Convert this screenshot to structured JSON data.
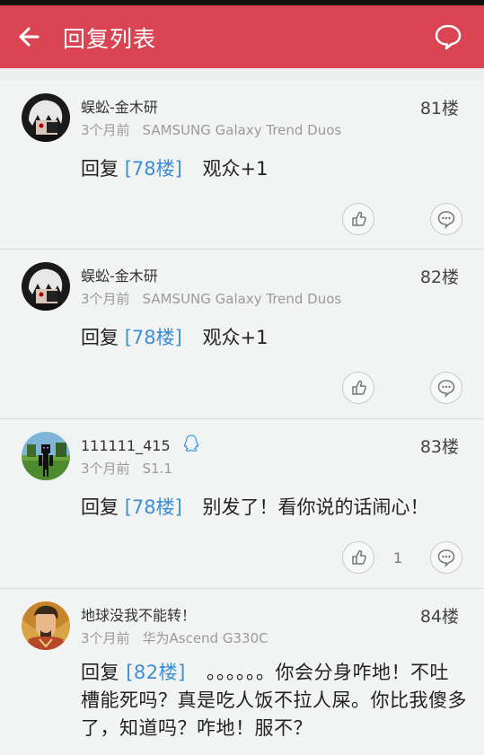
{
  "header": {
    "title": "回复列表"
  },
  "replies": [
    {
      "name": "蜈蚣-金木研",
      "floor": "81楼",
      "time": "3个月前",
      "device": "SAMSUNG Galaxy Trend Duos",
      "reply_prefix": "回复",
      "reply_ref": "[78楼]",
      "text": "观众+1",
      "like_count": "",
      "avatar_icon": "kaneki-avatar"
    },
    {
      "name": "蜈蚣-金木研",
      "floor": "82楼",
      "time": "3个月前",
      "device": "SAMSUNG Galaxy Trend Duos",
      "reply_prefix": "回复",
      "reply_ref": "[78楼]",
      "text": "观众+1",
      "like_count": "",
      "avatar_icon": "kaneki-avatar"
    },
    {
      "name": "111111_415",
      "floor": "83楼",
      "time": "3个月前",
      "device": "S1.1",
      "reply_prefix": "回复",
      "reply_ref": "[78楼]",
      "text": "别发了！看你说的话闹心！",
      "like_count": "1",
      "avatar_icon": "minecraft-avatar",
      "badge_icon": "qq-icon"
    },
    {
      "name": "地球没我不能转！",
      "floor": "84楼",
      "time": "3个月前",
      "device": "华为Ascend G330C",
      "reply_prefix": "回复",
      "reply_ref": "[82楼]",
      "text": "。。。。。。你会分身咋地！不吐槽能死吗？真是吃人饭不拉人屎。你比我傻多了，知道吗？咋地！服不？",
      "like_count": "",
      "avatar_icon": "warrior-avatar"
    }
  ],
  "colors": {
    "header_bg": "#d94553",
    "link": "#3c8ed8",
    "page_bg": "#eef0f0"
  }
}
